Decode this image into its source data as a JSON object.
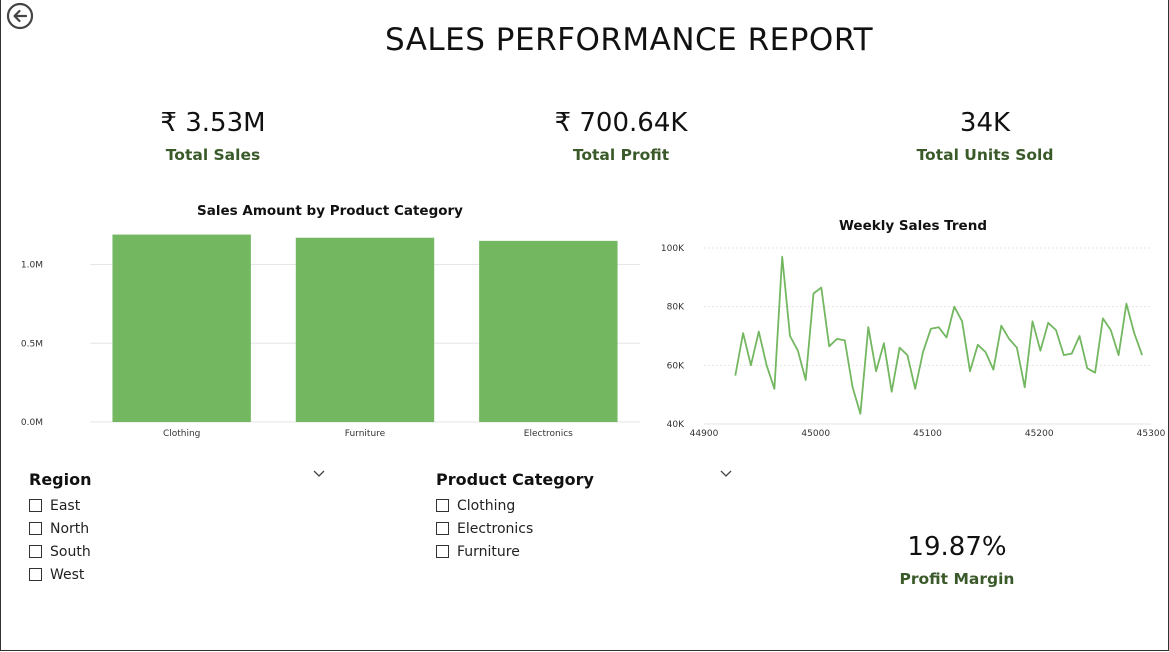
{
  "title": "SALES PERFORMANCE REPORT",
  "kpis": {
    "total_sales": {
      "value": "₹ 3.53M",
      "label": "Total Sales"
    },
    "total_profit": {
      "value": "₹ 700.64K",
      "label": "Total Profit"
    },
    "total_units": {
      "value": "34K",
      "label": "Total Units Sold"
    },
    "profit_margin": {
      "value": "19.87%",
      "label": "Profit Margin"
    }
  },
  "colors": {
    "bar": "#73b761",
    "kpi_label": "#3a5a2a",
    "grid": "#e6e6e6"
  },
  "slicers": {
    "region": {
      "title": "Region",
      "items": [
        "East",
        "North",
        "South",
        "West"
      ]
    },
    "category": {
      "title": "Product Category",
      "items": [
        "Clothing",
        "Electronics",
        "Furniture"
      ]
    }
  },
  "chart_data": [
    {
      "type": "bar",
      "title": "Sales Amount by Product Category",
      "categories": [
        "Clothing",
        "Furniture",
        "Electronics"
      ],
      "values": [
        1190000,
        1170000,
        1150000
      ],
      "ylim": [
        0,
        1200000
      ],
      "yticks": [
        "0.0M",
        "0.5M",
        "1.0M"
      ],
      "grid": true
    },
    {
      "type": "line",
      "title": "Weekly Sales Trend",
      "xlim": [
        44900,
        45300
      ],
      "ylim": [
        40000,
        100000
      ],
      "xticks": [
        "44900",
        "45000",
        "45100",
        "45200",
        "45300"
      ],
      "yticks": [
        "40K",
        "60K",
        "80K",
        "100K"
      ],
      "grid": true,
      "x": [
        44928,
        44935,
        44942,
        44949,
        44956,
        44963,
        44970,
        44977,
        44984,
        44991,
        44998,
        45005,
        45012,
        45019,
        45026,
        45033,
        45040,
        45047,
        45054,
        45061,
        45068,
        45075,
        45082,
        45089,
        45096,
        45103,
        45110,
        45117,
        45124,
        45131,
        45138,
        45145,
        45152,
        45159,
        45166,
        45173,
        45180,
        45187,
        45194,
        45201,
        45208,
        45215,
        45222,
        45229,
        45236,
        45243,
        45250,
        45257,
        45264,
        45271,
        45278,
        45285,
        45292
      ],
      "y": [
        56500,
        71000,
        60000,
        71500,
        60000,
        52000,
        97000,
        70000,
        65000,
        55000,
        84500,
        86500,
        66500,
        69000,
        68500,
        52500,
        43500,
        73000,
        58000,
        67500,
        51000,
        66000,
        63500,
        52000,
        64500,
        72500,
        73000,
        69500,
        80000,
        75000,
        58000,
        67000,
        64500,
        58500,
        73500,
        69000,
        66000,
        52500,
        75000,
        65000,
        74500,
        72000,
        63500,
        64000,
        70000,
        59000,
        57500,
        76000,
        72000,
        63500,
        81000,
        71000,
        63500
      ]
    }
  ]
}
